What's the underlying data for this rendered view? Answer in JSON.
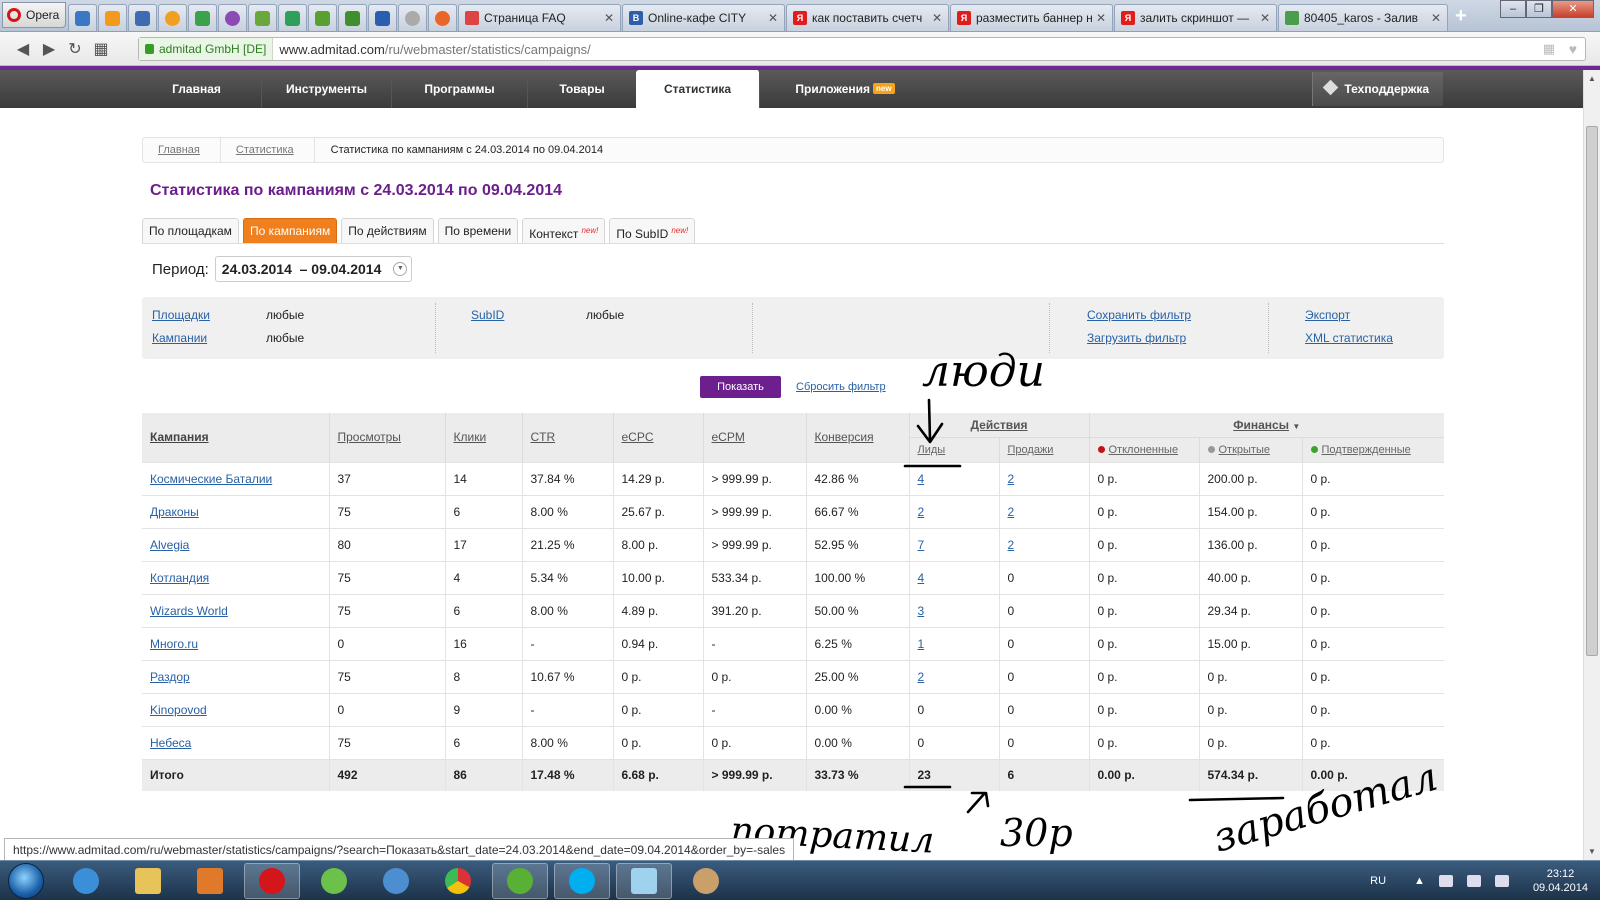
{
  "browser": {
    "menu_label": "Opera",
    "tabs": [
      {
        "title": "Страница FAQ",
        "fav_color": "#d44"
      },
      {
        "title": "Online-кафе CITY",
        "fav_color": "#2f5fa8"
      },
      {
        "title": "как поставить счетч",
        "fav_color": "#e01c1c"
      },
      {
        "title": "разместить баннер н",
        "fav_color": "#e01c1c"
      },
      {
        "title": "залить скриншот —",
        "fav_color": "#e01c1c"
      },
      {
        "title": "80405_karos - Залив",
        "fav_color": "#4a9d4a"
      }
    ],
    "secure_label": "admitad GmbH [DE]",
    "url_host": "www.admitad.com",
    "url_path": "/ru/webmaster/statistics/campaigns/"
  },
  "nav": {
    "items": [
      "Главная",
      "Инструменты",
      "Программы",
      "Товары",
      "Статистика",
      "Приложения"
    ],
    "new_badge": "new",
    "support": "Техподдержка"
  },
  "breadcrumb": {
    "home": "Главная",
    "stats": "Статистика",
    "current": "Статистика по кампаниям с 24.03.2014 по 09.04.2014"
  },
  "page_title": "Статистика по кампаниям с 24.03.2014 по 09.04.2014",
  "report_tabs": [
    {
      "label": "По площадкам",
      "new": ""
    },
    {
      "label": "По кампаниям",
      "new": ""
    },
    {
      "label": "По действиям",
      "new": ""
    },
    {
      "label": "По времени",
      "new": ""
    },
    {
      "label": "Контекст",
      "new": "new!"
    },
    {
      "label": "По SubID",
      "new": "new!"
    }
  ],
  "period": {
    "label": "Период:",
    "value": "24.03.2014  – 09.04.2014"
  },
  "filters": {
    "sites_label": "Площадки",
    "sites_value": "любые",
    "campaigns_label": "Кампании",
    "campaigns_value": "любые",
    "subid_label": "SubID",
    "subid_value": "любые",
    "save_filter": "Сохранить фильтр",
    "load_filter": "Загрузить фильтр",
    "export": "Экспорт",
    "xml": "XML статистика"
  },
  "show_button": "Показать",
  "reset_filter": "Сбросить фильтр",
  "table": {
    "headers": {
      "campaign": "Кампания",
      "views": "Просмотры",
      "clicks": "Клики",
      "ctr": "CTR",
      "ecpc": "eCPC",
      "ecpm": "eCPM",
      "conversion": "Конверсия",
      "actions": "Действия",
      "leads": "Лиды",
      "sales": "Продажи",
      "finance": "Финансы",
      "rejected": "Отклоненные",
      "open": "Открытые",
      "confirmed": "Подтвержденные"
    },
    "rows": [
      [
        "Космические Баталии",
        "37",
        "14",
        "37.84 %",
        "14.29 р.",
        "> 999.99 р.",
        "42.86 %",
        "4",
        "2",
        "0 р.",
        "200.00 р.",
        "0 р."
      ],
      [
        "Драконы",
        "75",
        "6",
        "8.00 %",
        "25.67 р.",
        "> 999.99 р.",
        "66.67 %",
        "2",
        "2",
        "0 р.",
        "154.00 р.",
        "0 р."
      ],
      [
        "Alvegia",
        "80",
        "17",
        "21.25 %",
        "8.00 р.",
        "> 999.99 р.",
        "52.95 %",
        "7",
        "2",
        "0 р.",
        "136.00 р.",
        "0 р."
      ],
      [
        "Котландия",
        "75",
        "4",
        "5.34 %",
        "10.00 р.",
        "533.34 р.",
        "100.00 %",
        "4",
        "0",
        "0 р.",
        "40.00 р.",
        "0 р."
      ],
      [
        "Wizards World",
        "75",
        "6",
        "8.00 %",
        "4.89 р.",
        "391.20 р.",
        "50.00 %",
        "3",
        "0",
        "0 р.",
        "29.34 р.",
        "0 р."
      ],
      [
        "Много.ru",
        "0",
        "16",
        "-",
        "0.94 р.",
        "-",
        "6.25 %",
        "1",
        "0",
        "0 р.",
        "15.00 р.",
        "0 р."
      ],
      [
        "Раздор",
        "75",
        "8",
        "10.67 %",
        "0 р.",
        "0 р.",
        "25.00 %",
        "2",
        "0",
        "0 р.",
        "0 р.",
        "0 р."
      ],
      [
        "Kinopovod",
        "0",
        "9",
        "-",
        "0 р.",
        "-",
        "0.00 %",
        "0",
        "0",
        "0 р.",
        "0 р.",
        "0 р."
      ],
      [
        "Небеса",
        "75",
        "6",
        "8.00 %",
        "0 р.",
        "0 р.",
        "0.00 %",
        "0",
        "0",
        "0 р.",
        "0 р.",
        "0 р."
      ]
    ],
    "total": [
      "Итого",
      "492",
      "86",
      "17.48 %",
      "6.68 р.",
      "> 999.99 р.",
      "33.73 %",
      "23",
      "6",
      "0.00 р.",
      "574.34 р.",
      "0.00 р."
    ],
    "colors": {
      "rejected": "#c0141c",
      "open": "#999999",
      "confirmed": "#3aa52b"
    }
  },
  "annotations": {
    "people": "люди",
    "spent": "потратил",
    "spent_amount": "30р",
    "earned": "заработал"
  },
  "status_url": "https://www.admitad.com/ru/webmaster/statistics/campaigns/?search=Показать&start_date=24.03.2014&end_date=09.04.2014&order_by=-sales",
  "taskbar": {
    "lang": "RU",
    "time": "23:12",
    "date": "09.04.2014"
  }
}
